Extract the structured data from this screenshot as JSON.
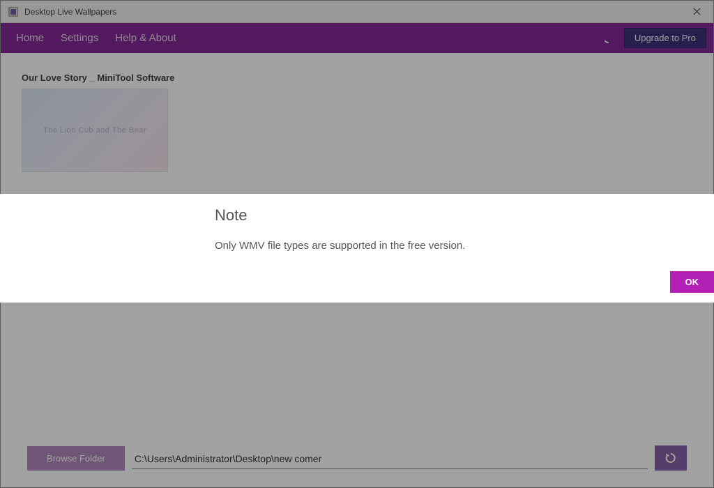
{
  "titlebar": {
    "app_title": "Desktop Live Wallpapers"
  },
  "nav": {
    "home": "Home",
    "settings": "Settings",
    "help": "Help & About",
    "upgrade": "Upgrade to Pro"
  },
  "content": {
    "wallpaper_title": "Our Love Story _ MiniTool Software",
    "thumb_caption": "The Lion Cub and The Bear"
  },
  "bottom": {
    "browse_label": "Browse Folder",
    "path_value": "C:\\Users\\Administrator\\Desktop\\new comer"
  },
  "dialog": {
    "title": "Note",
    "message": "Only WMV file types are supported in the free version.",
    "ok_label": "OK"
  }
}
